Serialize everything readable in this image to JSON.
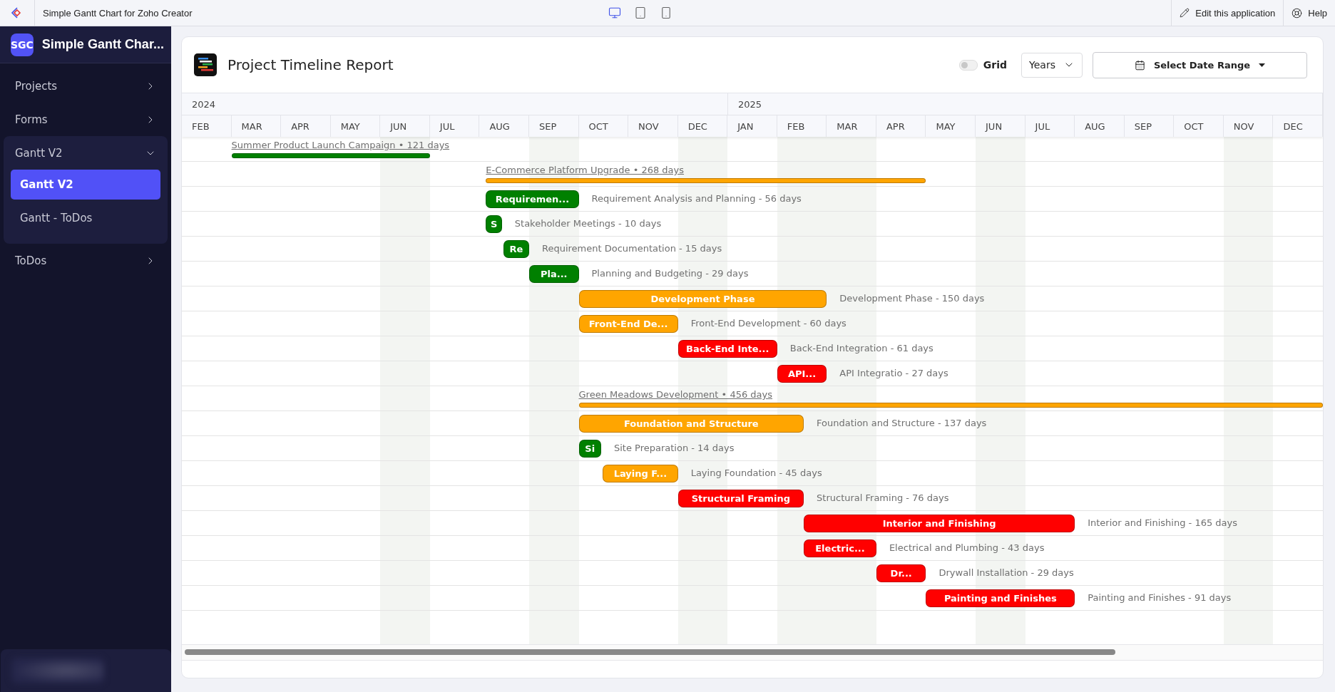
{
  "topbar": {
    "app_title": "Simple Gantt Chart for Zoho Creator",
    "devices": [
      {
        "kind": "desktop",
        "selected": true
      },
      {
        "kind": "tablet",
        "selected": false
      },
      {
        "kind": "phone",
        "selected": false
      }
    ],
    "edit_link": "Edit this application",
    "help_link": "Help"
  },
  "sidebar": {
    "logo": "SGC",
    "title": "Simple Gantt Char...",
    "items": [
      {
        "label": "Projects",
        "expanded": false,
        "selected": false
      },
      {
        "label": "Forms",
        "expanded": false,
        "selected": false
      },
      {
        "label": "Gantt V2",
        "expanded": true,
        "selected": false,
        "children": [
          {
            "label": "Gantt V2",
            "selected": true
          },
          {
            "label": "Gantt - ToDos",
            "selected": false
          }
        ]
      },
      {
        "label": "ToDos",
        "expanded": false,
        "selected": false
      }
    ]
  },
  "report": {
    "title": "Project Timeline Report",
    "grid_toggle": {
      "label": "Grid",
      "on": false
    },
    "scale_select": {
      "value": "Years"
    },
    "date_range_button": "Select Date Range",
    "timeline": {
      "years": [
        {
          "label": "2024"
        },
        {
          "label": "2025"
        }
      ],
      "months": [
        {
          "label": "FEB",
          "shaded": false
        },
        {
          "label": "MAR",
          "shaded": false
        },
        {
          "label": "APR",
          "shaded": false
        },
        {
          "label": "MAY",
          "shaded": false
        },
        {
          "label": "JUN",
          "shaded": true
        },
        {
          "label": "JUL",
          "shaded": false
        },
        {
          "label": "AUG",
          "shaded": false
        },
        {
          "label": "SEP",
          "shaded": true
        },
        {
          "label": "OCT",
          "shaded": false
        },
        {
          "label": "NOV",
          "shaded": false
        },
        {
          "label": "DEC",
          "shaded": true
        },
        {
          "label": "JAN",
          "shaded": false
        },
        {
          "label": "FEB",
          "shaded": true
        },
        {
          "label": "MAR",
          "shaded": true
        },
        {
          "label": "APR",
          "shaded": false
        },
        {
          "label": "MAY",
          "shaded": false
        },
        {
          "label": "JUN",
          "shaded": true
        },
        {
          "label": "JUL",
          "shaded": false
        },
        {
          "label": "AUG",
          "shaded": false
        },
        {
          "label": "SEP",
          "shaded": false
        },
        {
          "label": "OCT",
          "shaded": false
        },
        {
          "label": "NOV",
          "shaded": true
        },
        {
          "label": "DEC",
          "shaded": false
        }
      ],
      "rows": [
        {
          "kind": "project",
          "color": "#008000",
          "label": "Summer Product Launch Campaign • 121 days"
        },
        {
          "kind": "project",
          "color": "#ffa500",
          "label": "E-Commerce Platform Upgrade • 268 days"
        },
        {
          "kind": "task",
          "color": "#008000",
          "bar_label": "Requiremen...",
          "label": "Requirement Analysis and Planning - 56 days"
        },
        {
          "kind": "task",
          "color": "#008000",
          "bar_label": "S",
          "label": "Stakeholder Meetings - 10 days"
        },
        {
          "kind": "task",
          "color": "#008000",
          "bar_label": "Re",
          "label": "Requirement Documentation - 15 days"
        },
        {
          "kind": "task",
          "color": "#008000",
          "bar_label": "Pla...",
          "label": "Planning and Budgeting - 29 days"
        },
        {
          "kind": "task",
          "color": "#ffa500",
          "bar_label": "Development Phase",
          "label": "Development Phase - 150 days"
        },
        {
          "kind": "task",
          "color": "#ffa500",
          "bar_label": "Front-End De...",
          "label": "Front-End Development - 60 days"
        },
        {
          "kind": "task",
          "color": "#ff0000",
          "bar_label": "Back-End Inte...",
          "label": "Back-End Integration - 61 days"
        },
        {
          "kind": "task",
          "color": "#ff0000",
          "bar_label": "API...",
          "label": "API Integratio - 27 days"
        },
        {
          "kind": "project",
          "color": "#ffa500",
          "label": "Green Meadows Development • 456 days"
        },
        {
          "kind": "task",
          "color": "#ffa500",
          "bar_label": "Foundation and Structure",
          "label": "Foundation and Structure - 137 days"
        },
        {
          "kind": "task",
          "color": "#008000",
          "bar_label": "Si",
          "label": "Site Preparation - 14 days"
        },
        {
          "kind": "task",
          "color": "#ffa500",
          "bar_label": "Laying F...",
          "label": "Laying Foundation - 45 days"
        },
        {
          "kind": "task",
          "color": "#ff0000",
          "bar_label": "Structural Framing",
          "label": "Structural Framing - 76 days"
        },
        {
          "kind": "task",
          "color": "#ff0000",
          "bar_label": "Interior and Finishing",
          "label": "Interior and Finishing - 165 days"
        },
        {
          "kind": "task",
          "color": "#ff0000",
          "bar_label": "Electric...",
          "label": "Electrical and Plumbing - 43 days"
        },
        {
          "kind": "task",
          "color": "#ff0000",
          "bar_label": "Dr...",
          "label": "Drywall Installation - 29 days"
        },
        {
          "kind": "task",
          "color": "#ff0000",
          "bar_label": "Painting and Finishes",
          "label": "Painting and Finishes - 91 days"
        }
      ]
    }
  }
}
